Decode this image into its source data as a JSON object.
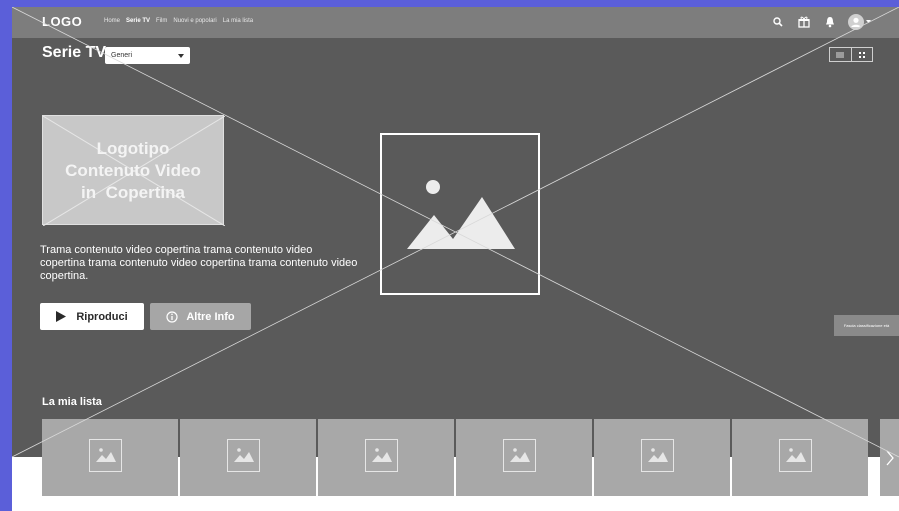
{
  "topbar": {
    "logo": "LOGO",
    "nav": [
      "Home",
      "Serie TV",
      "Film",
      "Nuovi e popolari",
      "La mia lista"
    ],
    "active_nav": "Serie TV",
    "icons": [
      "search-icon",
      "gift-icon",
      "bell-icon",
      "avatar-icon",
      "caret-down-icon"
    ]
  },
  "page": {
    "title": "Serie TV",
    "genre_select": "Generi",
    "view_toggle_icons": [
      "list-view-icon",
      "grid-view-icon"
    ]
  },
  "cover": {
    "logo_lines": [
      "Logotipo",
      "Contenuto Video",
      "in  Copertina"
    ],
    "plot": "Trama contenuto video copertina trama contenuto video copertina trama contenuto video copertina trama contenuto video copertina.",
    "play_label": "Riproduci",
    "info_label": "Altre Info",
    "rating_tag": "Fascia classificazione età"
  },
  "row": {
    "title": "La mia lista",
    "items_count": 7
  },
  "colors": {
    "hero_bg": "#5a5a5a",
    "topbar_bg": "#7d7d7d",
    "page_outer": "#5b5fd9"
  }
}
